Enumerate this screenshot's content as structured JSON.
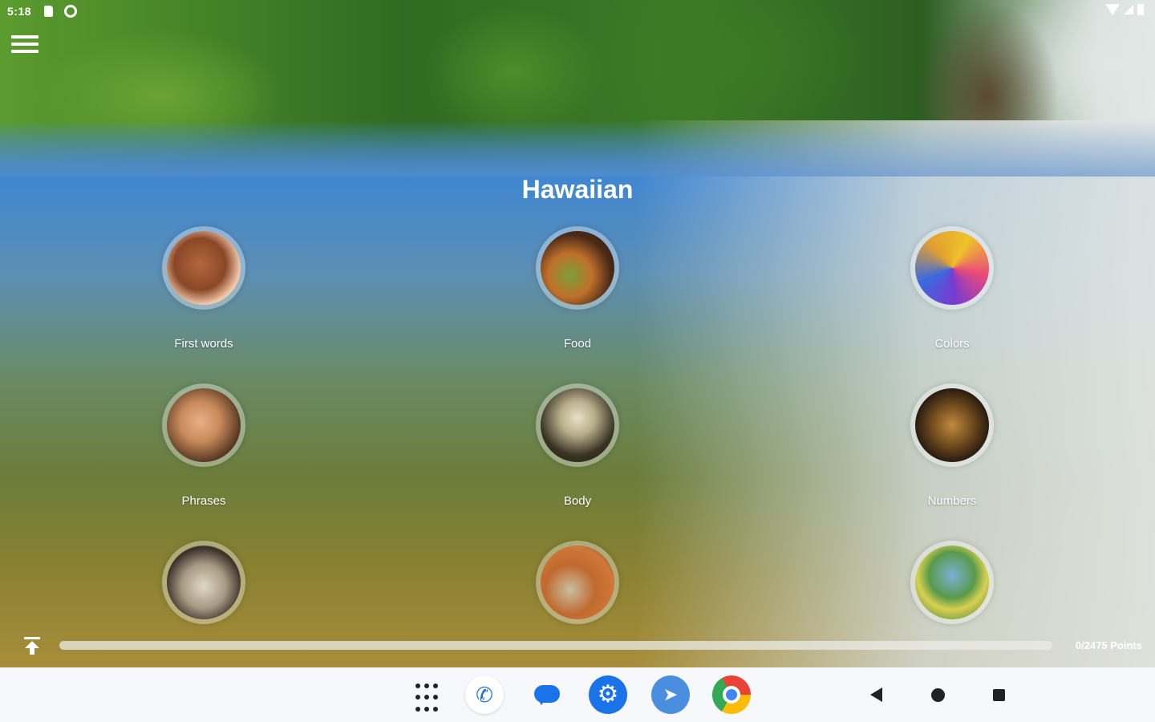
{
  "status_bar": {
    "time": "5:18",
    "left_icons": [
      "sd-card-icon",
      "cast-icon"
    ],
    "right_icons": [
      "wifi-icon",
      "signal-icon",
      "battery-icon"
    ]
  },
  "header": {
    "menu_icon": "hamburger-menu-icon",
    "title": "Hawaiian"
  },
  "categories": [
    {
      "label": "First words",
      "icon": "first-words-image"
    },
    {
      "label": "Food",
      "icon": "food-image"
    },
    {
      "label": "Colors",
      "icon": "colors-image"
    },
    {
      "label": "Phrases",
      "icon": "phrases-image"
    },
    {
      "label": "Body",
      "icon": "body-image"
    },
    {
      "label": "Numbers",
      "icon": "numbers-image"
    },
    {
      "label": "",
      "icon": "clock-image"
    },
    {
      "label": "",
      "icon": "market-image"
    },
    {
      "label": "",
      "icon": "nature-image"
    }
  ],
  "progress": {
    "text": "0/2475 Points",
    "value": 0,
    "max": 2475,
    "fill_fraction": 0
  },
  "dock": {
    "apps": [
      "app-grid-icon",
      "phone-icon",
      "messages-icon",
      "settings-icon",
      "cursor-icon",
      "chrome-icon"
    ]
  },
  "nav": {
    "buttons": [
      "back-icon",
      "home-icon",
      "recents-icon"
    ]
  },
  "colors": {
    "accent": "#1a73e8",
    "title_text": "#ffffff",
    "nav_bar_bg": "#f6f8fb"
  }
}
